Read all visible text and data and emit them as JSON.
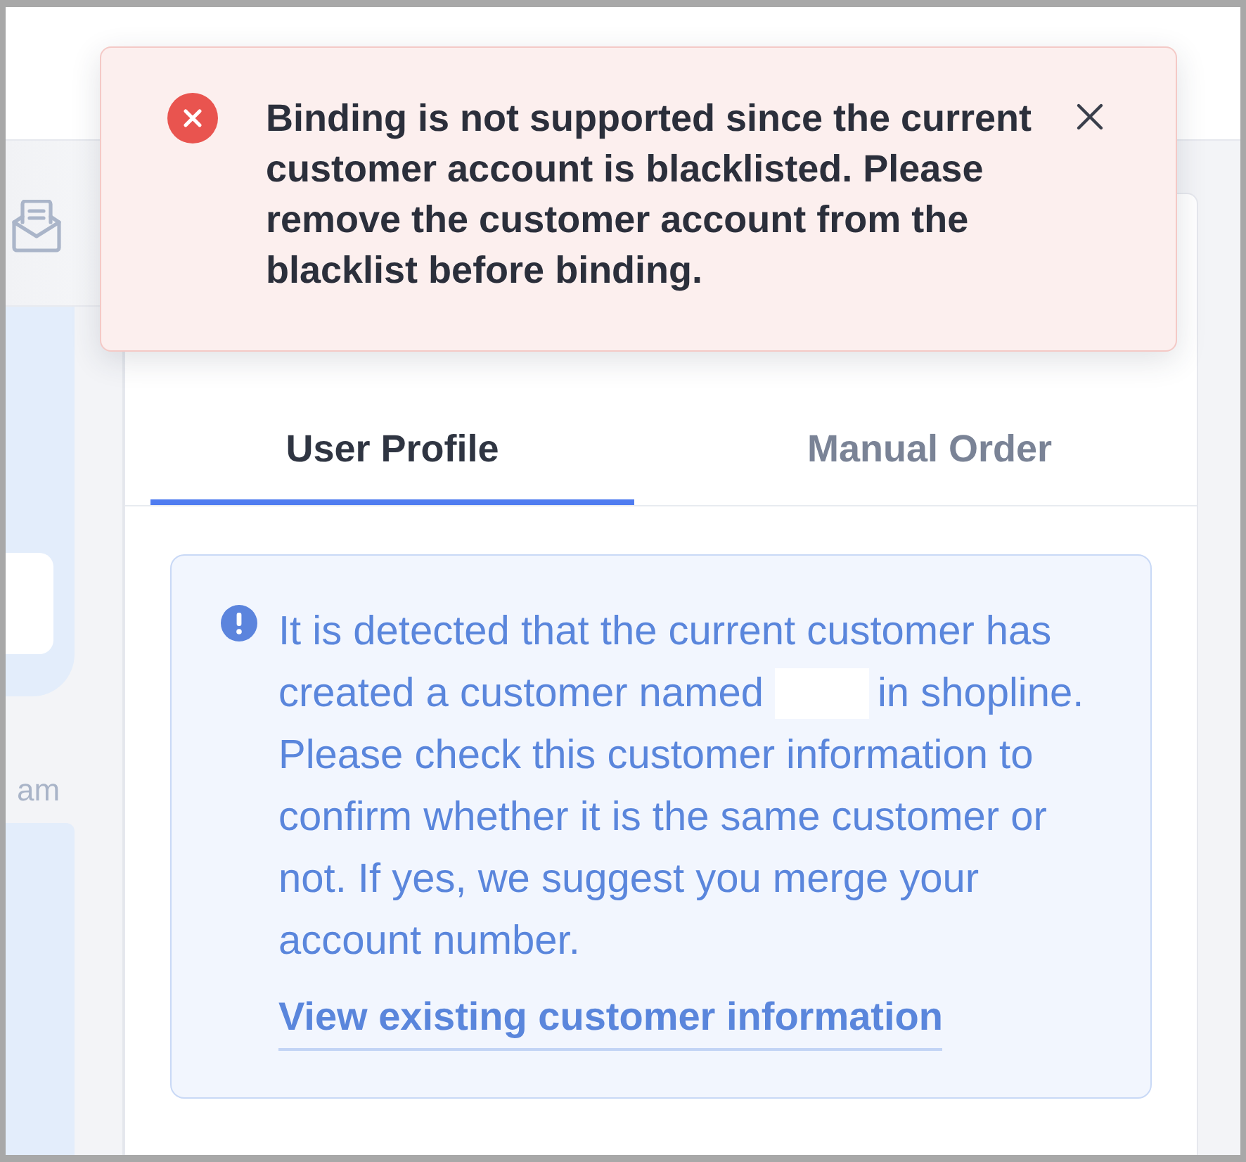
{
  "sidebar": {
    "time_label": "am"
  },
  "toast": {
    "kind": "error",
    "message": "Binding is not supported since the current customer account is blacklisted. Please remove the customer account from the blacklist before binding."
  },
  "tabs": [
    {
      "label": "User Profile",
      "selected": true
    },
    {
      "label": "Manual Order",
      "selected": false
    }
  ],
  "notice": {
    "kind": "info",
    "intro": "It is detected that the current customer has",
    "text_before_name": "created a customer named",
    "name_redacted": true,
    "text_after_name": "in shopline.",
    "details": "Please check this customer information to confirm whether it is the same customer or not. If yes, we suggest you merge your account number.",
    "link": "View existing customer information"
  }
}
